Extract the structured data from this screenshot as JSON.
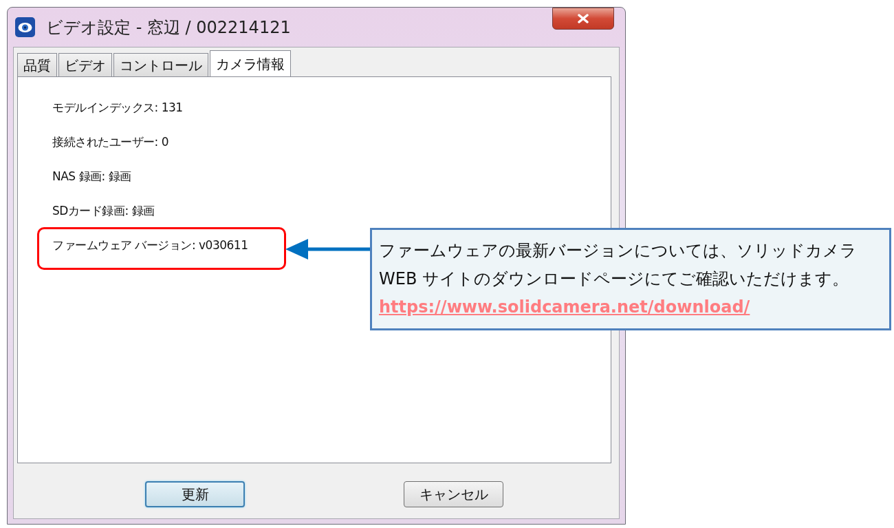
{
  "window": {
    "title": "ビデオ設定 - 窓辺 / 002214121"
  },
  "tabs": [
    {
      "label": "品質",
      "selected": false
    },
    {
      "label": "ビデオ",
      "selected": false
    },
    {
      "label": "コントロール",
      "selected": false
    },
    {
      "label": "カメラ情報",
      "selected": true
    }
  ],
  "info_lines": [
    {
      "text": "モデルインデックス: 131",
      "highlighted": false
    },
    {
      "text": "接続されたユーザー: 0",
      "highlighted": false
    },
    {
      "text": "NAS 録画: 録画",
      "highlighted": false
    },
    {
      "text": "SDカード録画: 録画",
      "highlighted": false
    },
    {
      "text": "ファームウェア バージョン: v030611",
      "highlighted": true
    }
  ],
  "buttons": [
    {
      "label": "更新",
      "default": true
    },
    {
      "label": "キャンセル",
      "default": false
    }
  ],
  "callout": {
    "lines": [
      "ファームウェアの最新バージョンについては、ソリッドカメラ",
      "WEB サイトのダウンロードページにてご確認いただけます。"
    ],
    "link": "https://www.solidcamera.net/download/"
  }
}
